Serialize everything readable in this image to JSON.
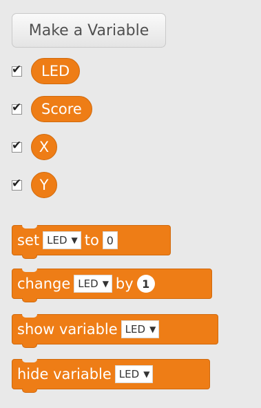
{
  "make_variable": {
    "label": "Make a Variable"
  },
  "variables": [
    {
      "name": "LED",
      "checked": true
    },
    {
      "name": "Score",
      "checked": true
    },
    {
      "name": "X",
      "checked": true
    },
    {
      "name": "Y",
      "checked": true
    }
  ],
  "blocks": {
    "set": {
      "label": "set",
      "variable": "LED",
      "to_label": "to",
      "value": "0"
    },
    "change": {
      "label": "change",
      "variable": "LED",
      "by_label": "by",
      "value": "1"
    },
    "show": {
      "label": "show variable",
      "variable": "LED"
    },
    "hide": {
      "label": "hide variable",
      "variable": "LED"
    }
  },
  "checkmark_symbol": "✔",
  "dropdown_arrow": "▼",
  "colors": {
    "variable_block": "#ee7d16",
    "palette_bg": "#e9e9e9"
  }
}
